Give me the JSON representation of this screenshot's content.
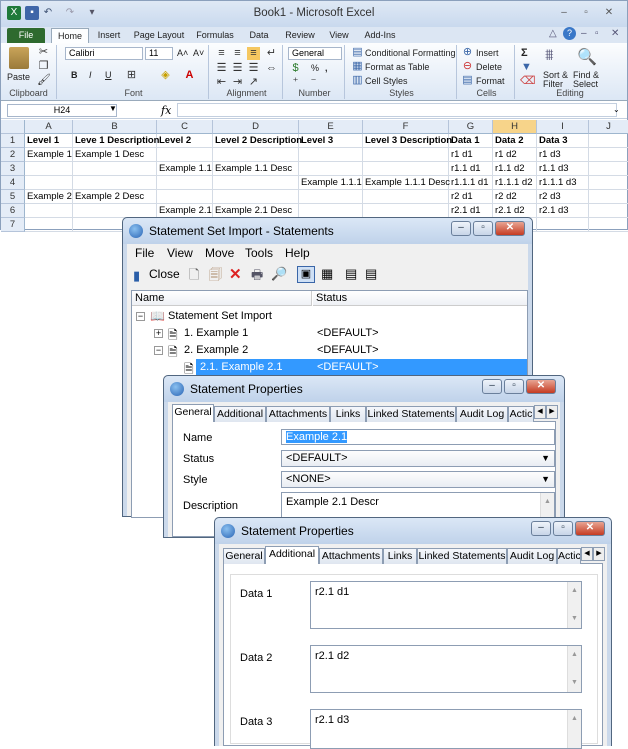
{
  "excel": {
    "title": "Book1 - Microsoft Excel",
    "tabs": [
      "File",
      "Home",
      "Insert",
      "Page Layout",
      "Formulas",
      "Data",
      "Review",
      "View",
      "Add-Ins"
    ],
    "ribbon": {
      "clipboard": {
        "paste": "Paste",
        "label": "Clipboard"
      },
      "font": {
        "name": "Calibri",
        "size": "11",
        "label": "Font",
        "bold": "B",
        "italic": "I",
        "underline": "U",
        "grow": "A˄",
        "shrink": "A˅"
      },
      "alignment": {
        "label": "Alignment"
      },
      "number": {
        "format": "General",
        "label": "Number",
        "percent": "%",
        "comma": ","
      },
      "styles": {
        "conditional": "Conditional Formatting",
        "format_table": "Format as Table",
        "cell_styles": "Cell Styles",
        "label": "Styles"
      },
      "cells": {
        "insert": "Insert",
        "delete": "Delete",
        "format": "Format",
        "label": "Cells"
      },
      "editing": {
        "sort": "Sort &",
        "filter": "Filter",
        "find": "Find &",
        "select": "Select",
        "label": "Editing",
        "sigma": "Σ"
      }
    },
    "name_box": "H24",
    "fx": "fx",
    "columns": [
      "A",
      "B",
      "C",
      "D",
      "E",
      "F",
      "G",
      "H",
      "I",
      "J"
    ],
    "rows": [
      "1",
      "2",
      "3",
      "4",
      "5",
      "6",
      "7"
    ],
    "cells": [
      [
        "Level 1",
        "Leve 1 Description",
        "Level 2",
        "Level 2 Description",
        "Level 3",
        "Level 3 Description",
        "Data 1",
        "Data 2",
        "Data 3",
        ""
      ],
      [
        "Example 1",
        "Example 1 Desc",
        "",
        "",
        "",
        "",
        "r1 d1",
        "r1 d2",
        "r1 d3",
        ""
      ],
      [
        "",
        "",
        "Example 1.1",
        "Example 1.1 Desc",
        "",
        "",
        "r1.1 d1",
        "r1.1 d2",
        "r1.1 d3",
        ""
      ],
      [
        "",
        "",
        "",
        "",
        "Example 1.1.1",
        "Example 1.1.1 Desc",
        "r1.1.1 d1",
        "r1.1.1 d2",
        "r1.1.1 d3",
        ""
      ],
      [
        "Example 2",
        "Example 2 Desc",
        "",
        "",
        "",
        "",
        "r2 d1",
        "r2 d2",
        "r2 d3",
        ""
      ],
      [
        "",
        "",
        "Example 2.1",
        "Example 2.1 Desc",
        "",
        "",
        "r2.1 d1",
        "r2.1 d2",
        "r2.1 d3",
        ""
      ],
      [
        "",
        "",
        "",
        "",
        "",
        "",
        "",
        "",
        "",
        ""
      ]
    ]
  },
  "ssi": {
    "title": "Statement Set Import - Statements",
    "menu": [
      "File",
      "View",
      "Move",
      "Tools",
      "Help"
    ],
    "toolbar": {
      "close": "Close"
    },
    "cols": {
      "name": "Name",
      "status": "Status"
    },
    "tree": [
      {
        "label": "Statement Set Import",
        "status": ""
      },
      {
        "label": "1. Example 1",
        "status": "<DEFAULT>"
      },
      {
        "label": "2. Example 2",
        "status": "<DEFAULT>"
      },
      {
        "label": "2.1. Example 2.1",
        "status": "<DEFAULT>"
      }
    ]
  },
  "sp1": {
    "title": "Statement Properties",
    "tabs": [
      "General",
      "Additional",
      "Attachments",
      "Links",
      "Linked Statements",
      "Audit Log",
      "Actic"
    ],
    "name_label": "Name",
    "name_value": "Example 2.1",
    "status_label": "Status",
    "status_value": "<DEFAULT>",
    "style_label": "Style",
    "style_value": "<NONE>",
    "desc_label": "Description",
    "desc_value": "Example 2.1 Descr"
  },
  "sp2": {
    "title": "Statement Properties",
    "tabs": [
      "General",
      "Additional",
      "Attachments",
      "Links",
      "Linked Statements",
      "Audit Log",
      "Actic"
    ],
    "fields": [
      {
        "label": "Data 1",
        "value": "r2.1 d1"
      },
      {
        "label": "Data 2",
        "value": "r2.1 d2"
      },
      {
        "label": "Data 3",
        "value": "r2.1 d3"
      }
    ]
  }
}
